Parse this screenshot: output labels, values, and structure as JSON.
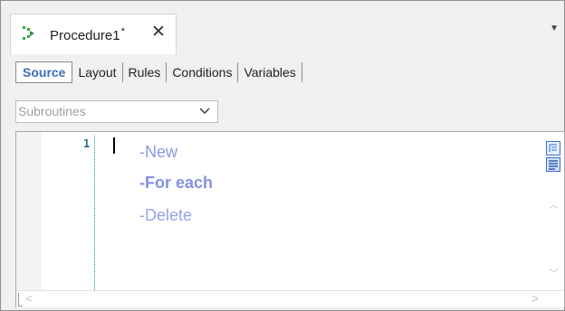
{
  "document_tab": {
    "title": "Procedure1",
    "modified_marker": "*",
    "close_glyph": "✕",
    "icon": "procedure-icon"
  },
  "subtabs": [
    {
      "label": "Source",
      "active": true
    },
    {
      "label": "Layout",
      "active": false
    },
    {
      "label": "Rules",
      "active": false
    },
    {
      "label": "Conditions",
      "active": false
    },
    {
      "label": "Variables",
      "active": false
    }
  ],
  "subroutines_dropdown": {
    "value": "Subroutines"
  },
  "editor": {
    "line_number": "1",
    "suggestions": [
      "-New",
      "-For each",
      "-Delete"
    ]
  },
  "colors": {
    "active_tab": "#3c6fbe",
    "suggestion": "#8a97e0",
    "line_number": "#2b6e8f"
  }
}
